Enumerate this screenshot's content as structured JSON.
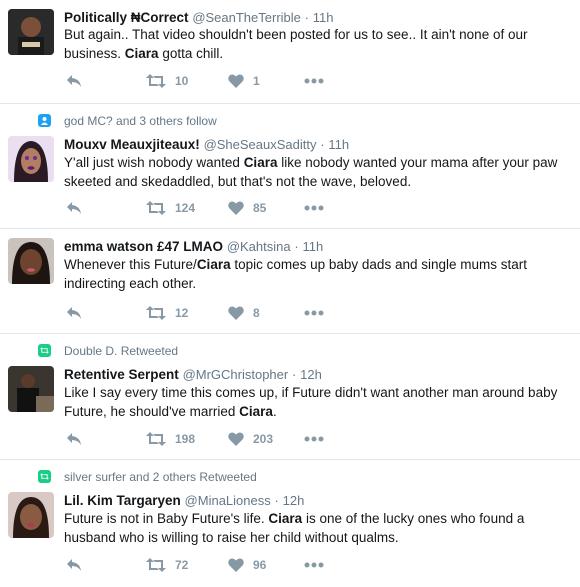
{
  "tweets": [
    {
      "context": "",
      "name": "Politically ₦Correct",
      "handle": "@SeanTheTerrible",
      "time": "11h",
      "text_parts": [
        "But again.. That video shouldn't been posted for us to see.. It ain't none of our business. ",
        "Ciara",
        " gotta chill."
      ],
      "retweets": "10",
      "likes": "1"
    },
    {
      "context": "god MC? and 3 others follow",
      "name": "Mouxv Meauxjiteaux!",
      "handle": "@SheSeauxSaditty",
      "time": "11h",
      "text_parts": [
        "Y'all just wish nobody wanted ",
        "Ciara",
        " like nobody wanted your mama after your paw skeeted and skedaddled, but that's not the wave, beloved."
      ],
      "retweets": "124",
      "likes": "85"
    },
    {
      "context": "",
      "name": "emma watson £47 LMAO",
      "handle": "@Kahtsina",
      "time": "11h",
      "text_parts": [
        "Whenever this Future/",
        "Ciara",
        " topic comes up baby dads and single mums start indirecting each other."
      ],
      "retweets": "12",
      "likes": "8"
    },
    {
      "context": "Double D. Retweeted",
      "name": "Retentive Serpent",
      "handle": "@MrGChristopher",
      "time": "12h",
      "text_parts": [
        "Like I say every time this comes up, if Future didn't want another man around baby Future, he should've married ",
        "Ciara",
        "."
      ],
      "retweets": "198",
      "likes": "203"
    },
    {
      "context": "silver surfer and 2 others Retweeted",
      "name": "Lil. Kim Targaryen",
      "handle": "@MinaLioness",
      "time": "12h",
      "text_parts": [
        "Future is not in Baby Future's life. ",
        "Ciara",
        " is one of the lucky ones who found a husband who is willing to raise her child without qualms."
      ],
      "retweets": "72",
      "likes": "96"
    }
  ],
  "colors": {
    "name": "#14171a",
    "meta": "#657786",
    "action": "#8899a6",
    "follow_icon": "#1da1f2",
    "retweet_icon": "#19cf86"
  },
  "icons": {
    "reply": "reply-icon",
    "retweet": "retweet-icon",
    "like": "heart-icon",
    "more": "more-dots-icon",
    "follow": "person-icon",
    "retweeted": "retweet-badge-icon"
  }
}
